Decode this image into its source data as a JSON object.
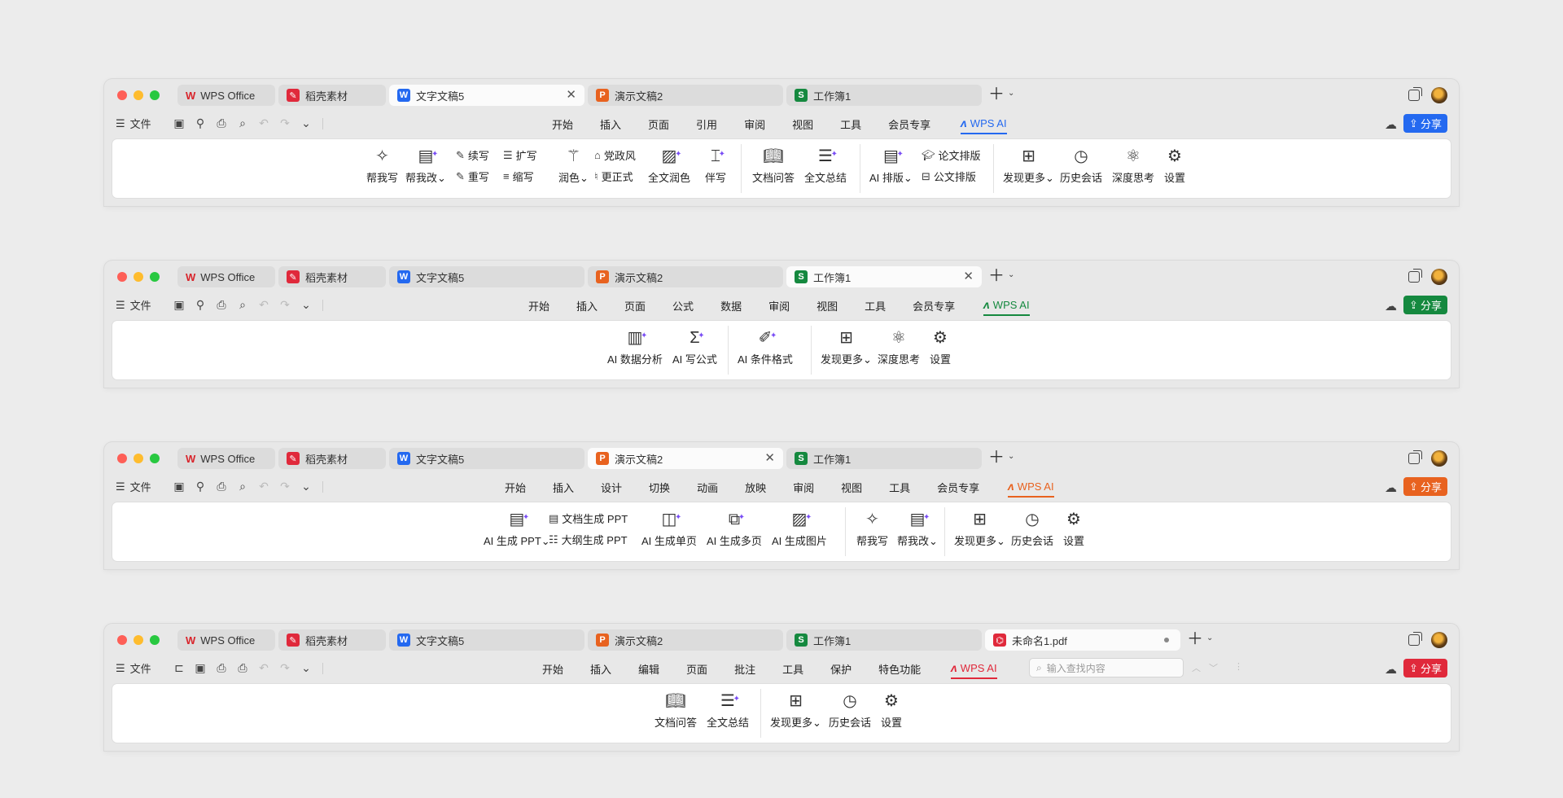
{
  "windows": [
    {
      "accent": "#2469f0",
      "menu": [
        "开始",
        "插入",
        "页面",
        "引用",
        "审阅",
        "视图",
        "工具",
        "会员专享"
      ],
      "ribbon": {
        "big_write": "帮我写",
        "big_change": "帮我改",
        "continue": "续写",
        "rewrite": "重写",
        "expand": "扩写",
        "shrink": "缩写",
        "polish": "润色",
        "party_style": "党政风",
        "formal": "更正式",
        "full_polish": "全文润色",
        "companion": "伴写",
        "doc_qa": "文档问答",
        "summary": "全文总结",
        "ai_layout": "AI 排版",
        "paper_layout": "论文排版",
        "official_layout": "公文排版",
        "discover": "发现更多",
        "history": "历史会话",
        "deep_think": "深度思考",
        "settings": "设置"
      }
    },
    {
      "accent": "#15893f",
      "menu": [
        "开始",
        "插入",
        "页面",
        "公式",
        "数据",
        "审阅",
        "视图",
        "工具",
        "会员专享"
      ],
      "ribbon": {
        "data_analysis": "AI 数据分析",
        "write_formula": "AI 写公式",
        "cond_format": "AI 条件格式",
        "discover": "发现更多",
        "deep_think": "深度思考",
        "settings": "设置"
      }
    },
    {
      "accent": "#e8621f",
      "menu": [
        "开始",
        "插入",
        "设计",
        "切换",
        "动画",
        "放映",
        "审阅",
        "视图",
        "工具",
        "会员专享"
      ],
      "ribbon": {
        "gen_ppt": "AI 生成 PPT",
        "doc_gen_ppt": "文档生成 PPT",
        "outline_gen_ppt": "大纲生成 PPT",
        "gen_single": "AI 生成单页",
        "gen_multi": "AI 生成多页",
        "gen_image": "AI 生成图片",
        "big_write": "帮我写",
        "big_change": "帮我改",
        "discover": "发现更多",
        "history": "历史会话",
        "settings": "设置"
      }
    },
    {
      "accent": "#e0293b",
      "menu": [
        "开始",
        "插入",
        "编辑",
        "页面",
        "批注",
        "工具",
        "保护",
        "特色功能"
      ],
      "search_placeholder": "输入查找内容",
      "ribbon": {
        "doc_qa": "文档问答",
        "summary": "全文总结",
        "discover": "发现更多",
        "history": "历史会话",
        "settings": "设置"
      }
    }
  ],
  "common": {
    "tabs": {
      "wps": "WPS Office",
      "daoke": "稻壳素材",
      "doc": "文字文稿5",
      "ppt": "演示文稿2",
      "sheet": "工作簿1",
      "pdf": "未命名1.pdf"
    },
    "tab_icons": {
      "doc": "W",
      "ppt": "P",
      "sheet": "S"
    },
    "file_menu": "文件",
    "wps_ai": "WPS AI",
    "share": "分享",
    "colors": {
      "doc": "#2469f0",
      "ppt": "#e8621f",
      "sheet": "#15893f",
      "pdf": "#e0293b",
      "wps": "#d8242b"
    }
  }
}
